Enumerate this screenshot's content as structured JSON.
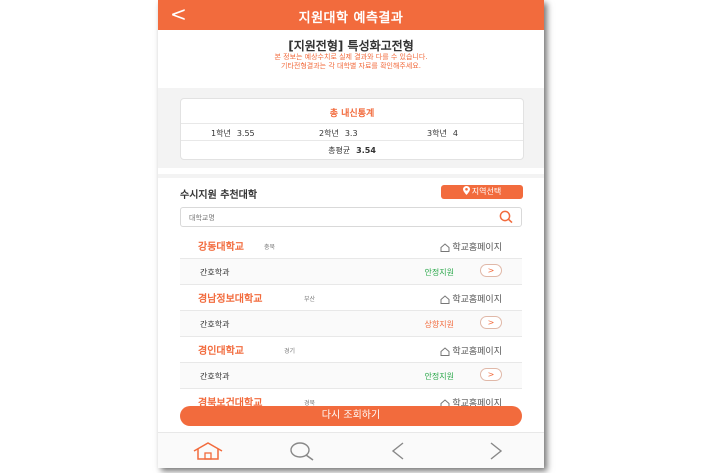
{
  "header": {
    "back_glyph": "<",
    "title": "지원대학 예측결과"
  },
  "heading": "[지원전형] 특성화고전형",
  "notice": [
    "본 정보는 예상수치로 실제 결과와 다를 수 있습니다.",
    "기타전형결과는 각 대학별 자료를 확인해주세요."
  ],
  "summary": {
    "title": "총 내신통계",
    "grades": [
      {
        "label": "1학년",
        "value": "3.55"
      },
      {
        "label": "2학년",
        "value": "3.3"
      },
      {
        "label": "3학년",
        "value": "4"
      }
    ],
    "avg_label": "총평균",
    "avg_value": "3.54"
  },
  "section": {
    "title": "수시지원 추천대학",
    "region_button": "지역선택",
    "search_placeholder": "대학교명"
  },
  "universities": [
    {
      "name": "강동대학교",
      "region": "충북",
      "homepage": "학교홈페이지",
      "dept": "간호학과",
      "status": "안정지원",
      "status_color": "#2aa84a",
      "go": ">"
    },
    {
      "name": "경남정보대학교",
      "region": "부산",
      "homepage": "학교홈페이지",
      "dept": "간호학과",
      "status": "상향지원",
      "status_color": "#f26b3d",
      "go": ">"
    },
    {
      "name": "경인대학교",
      "region": "경기",
      "homepage": "학교홈페이지",
      "dept": "간호학과",
      "status": "안정지원",
      "status_color": "#2aa84a",
      "go": ">"
    },
    {
      "name": "경북보건대학교",
      "region": "경북",
      "homepage": "학교홈페이지"
    }
  ],
  "requery_button": "다시 조회하기",
  "bottom_nav": {
    "icons": [
      "home-icon",
      "search-icon",
      "prev-icon",
      "next-icon"
    ]
  },
  "colors": {
    "accent": "#f26b3d",
    "safe": "#2aa84a",
    "upward": "#f26b3d"
  }
}
